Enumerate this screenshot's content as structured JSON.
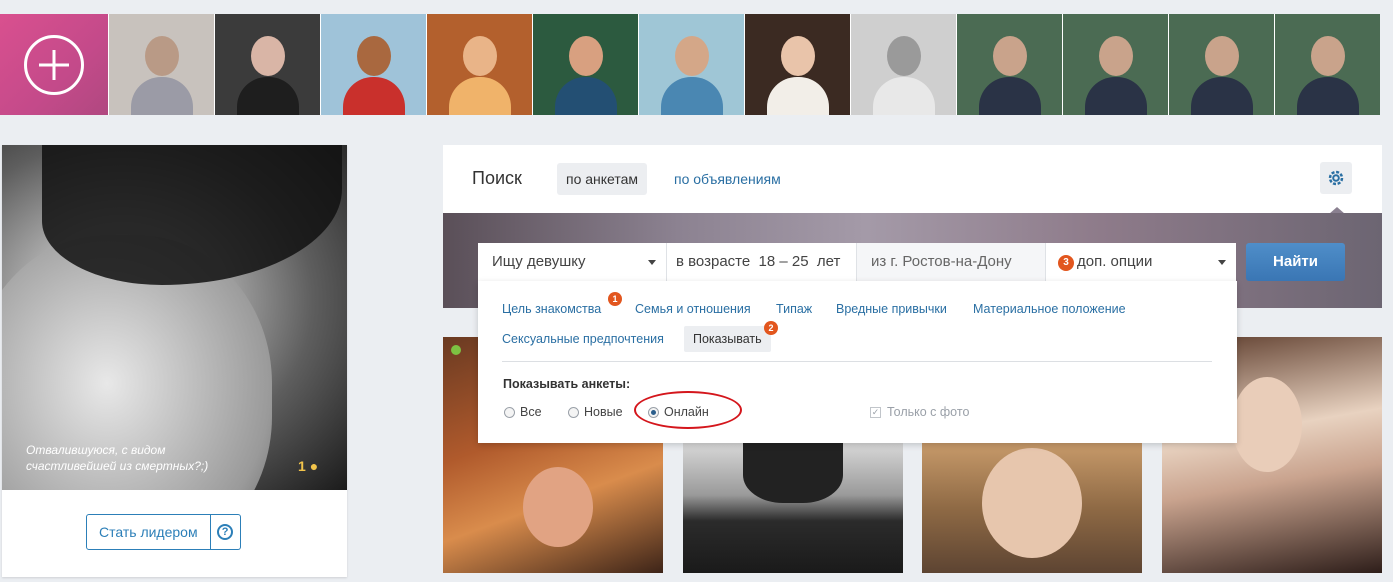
{
  "strip": {
    "add_label": "",
    "thumbs": [
      {
        "tone": "#c8c2bd",
        "head": "#b99a86",
        "body": "#9b9ba6"
      },
      {
        "tone": "#3b3b3b",
        "head": "#d9b5a6",
        "body": "#1e1e1e"
      },
      {
        "tone": "#9fc3d9",
        "head": "#a9683f",
        "body": "#c9302c"
      },
      {
        "tone": "#b3602d",
        "head": "#e9b488",
        "body": "#f0b36a"
      },
      {
        "tone": "#2c5a3f",
        "head": "#d8a080",
        "body": "#234f73"
      },
      {
        "tone": "#9fc6d6",
        "head": "#d4a788",
        "body": "#4a87b2"
      },
      {
        "tone": "#3b2a22",
        "head": "#e9c4aa",
        "body": "#f2eee8"
      },
      {
        "tone": "#cfcfcf",
        "head": "#9a9a9a",
        "body": "#e8e8e8"
      },
      {
        "tone": "#4b6b53",
        "head": "#c9a38b",
        "body": "#2a3346"
      },
      {
        "tone": "#4b6b53",
        "head": "#c9a38b",
        "body": "#2a3346"
      },
      {
        "tone": "#4b6b53",
        "head": "#c9a38b",
        "body": "#2a3346"
      },
      {
        "tone": "#4b6b53",
        "head": "#c9a38b",
        "body": "#2a3346"
      }
    ]
  },
  "profile": {
    "caption": "Отвалившуюся, с видом счастливейшей из смертных?;)",
    "coins": "1",
    "leader_label": "Стать лидером",
    "help_label": "?"
  },
  "search": {
    "title": "Поиск",
    "tab_profiles": "по анкетам",
    "tab_ads": "по объявлениям",
    "looking_for": "Ищу девушку",
    "age": "в возрасте  18 – 25  лет",
    "city": "из г. Ростов-на-Дону",
    "options_badge": "3",
    "options_label": "доп. опции",
    "find_label": "Найти"
  },
  "dropdown": {
    "categories": [
      {
        "label": "Цель знакомства",
        "badge": "1"
      },
      {
        "label": "Семья и отношения"
      },
      {
        "label": "Типаж"
      },
      {
        "label": "Вредные привычки"
      },
      {
        "label": "Материальное положение"
      },
      {
        "label": "Сексуальные предпочтения"
      },
      {
        "label": "Показывать",
        "badge": "2"
      }
    ],
    "show_label": "Показывать анкеты:",
    "radio_all": "Все",
    "radio_new": "Новые",
    "radio_online": "Онлайн",
    "only_photo": "Только с фото"
  },
  "colors": {
    "accent": "#2a6fa3",
    "badge": "#e2561e",
    "find": "#3a76b4",
    "highlight": "#d4161c"
  }
}
